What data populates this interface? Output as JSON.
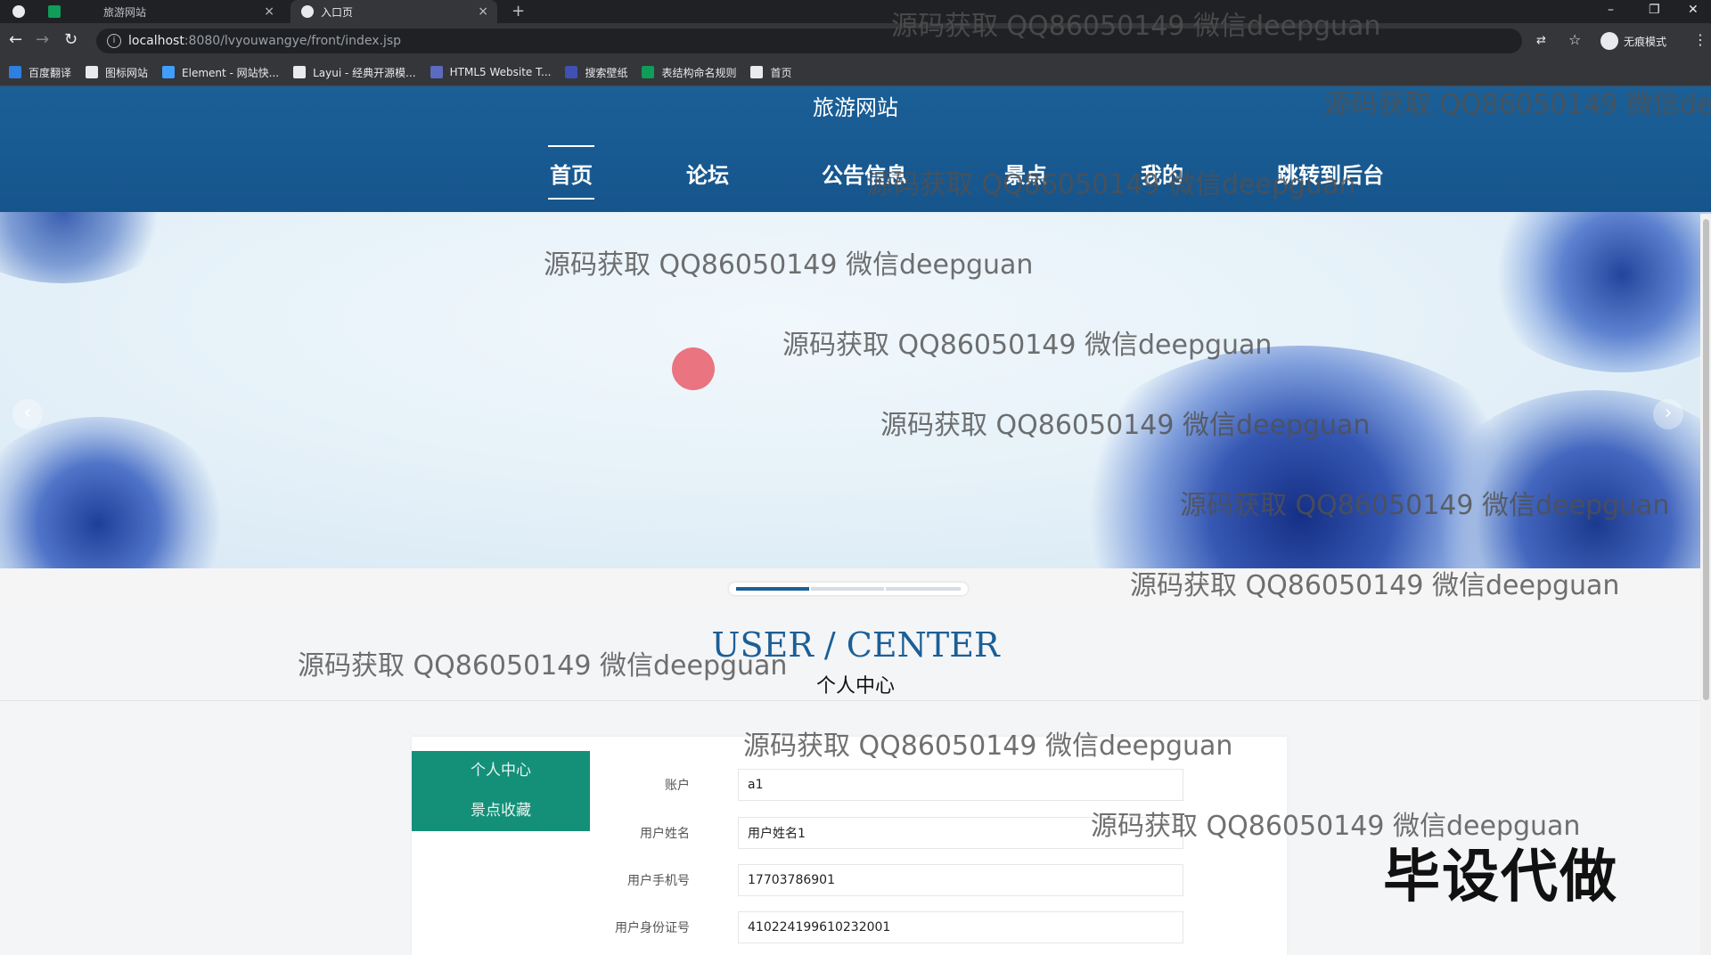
{
  "browser": {
    "tabs": [
      {
        "title": "旅游网站",
        "active": false
      },
      {
        "title": "入口页",
        "active": true
      }
    ],
    "new_tab": "+",
    "url_host": "localhost",
    "url_rest": ":8080/lvyouwangye/front/index.jsp",
    "profile_label": "无痕模式",
    "bookmarks": [
      {
        "label": "百度翻译",
        "icon": "translate-icon",
        "color": "#2f7fe0"
      },
      {
        "label": "图标网站",
        "icon": "flag-icon",
        "color": "#e8eaed"
      },
      {
        "label": "Element - 网站快...",
        "icon": "element-icon",
        "color": "#409eff"
      },
      {
        "label": "Layui - 经典开源模...",
        "icon": "layui-icon",
        "color": "#e8eaed"
      },
      {
        "label": "HTML5 Website T...",
        "icon": "html5-icon",
        "color": "#5c6bc0"
      },
      {
        "label": "搜索壁纸",
        "icon": "search-wallpaper-icon",
        "color": "#3f51b5"
      },
      {
        "label": "表结构命名规则",
        "icon": "sheet-icon",
        "color": "#0f9d58"
      },
      {
        "label": "首页",
        "icon": "globe-icon",
        "color": "#e8eaed"
      }
    ]
  },
  "site": {
    "title": "旅游网站",
    "nav": [
      "首页",
      "论坛",
      "公告信息",
      "景点",
      "我的",
      "跳转到后台"
    ],
    "active_nav": "首页",
    "carousel_pages": 3,
    "carousel_active": 1
  },
  "section": {
    "title_en": "USER / CENTER",
    "title_cn": "个人中心"
  },
  "side_menu": [
    "个人中心",
    "景点收藏"
  ],
  "form": {
    "fields": [
      {
        "label": "账户",
        "value": "a1"
      },
      {
        "label": "用户姓名",
        "value": "用户姓名1"
      },
      {
        "label": "用户手机号",
        "value": "17703786901"
      },
      {
        "label": "用户身份证号",
        "value": "410224199610232001"
      }
    ]
  },
  "watermark_text": "源码获取 QQ86050149 微信deepguan",
  "stamp_text": "毕设代做",
  "colors": {
    "header": "#1b5f97",
    "side_menu": "#149079",
    "section_title": "#1b5f97"
  }
}
